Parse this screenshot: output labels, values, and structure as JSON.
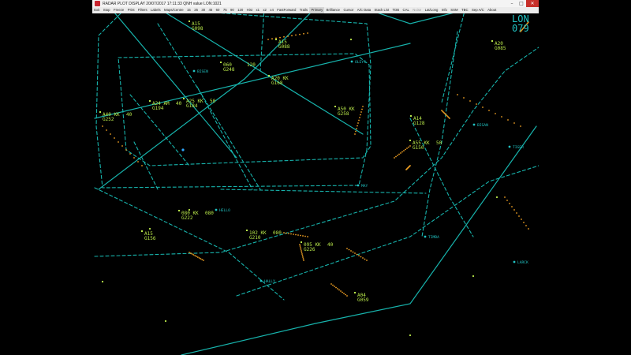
{
  "window": {
    "title": "RADAR PLOT DISPLAY  20/07/2017  17:11:33  QNH value  LON:1021",
    "buttons": [
      "–",
      "□",
      "✕"
    ]
  },
  "menu": [
    {
      "label": "Exit"
    },
    {
      "label": "Stop"
    },
    {
      "label": "Freeze"
    },
    {
      "label": "Print"
    },
    {
      "label": "Filters"
    },
    {
      "label": "Labels"
    },
    {
      "label": "Maps/Centre"
    },
    {
      "label": "15"
    },
    {
      "label": "25"
    },
    {
      "label": "30"
    },
    {
      "label": "45"
    },
    {
      "label": "60"
    },
    {
      "label": "75"
    },
    {
      "label": "90"
    },
    {
      "label": "120"
    },
    {
      "label": "Hist"
    },
    {
      "label": "x1"
    },
    {
      "label": "x2"
    },
    {
      "label": "x4"
    },
    {
      "label": "FastForward"
    },
    {
      "label": "Trails"
    },
    {
      "label": "Primary",
      "active": true
    },
    {
      "label": "Brilliance"
    },
    {
      "label": "Cursor"
    },
    {
      "label": "A/C Data"
    },
    {
      "label": "Stack List"
    },
    {
      "label": "TDB"
    },
    {
      "label": "CAL"
    },
    {
      "label": "Noise",
      "dim": true
    },
    {
      "label": "Lat/Long"
    },
    {
      "label": "Info"
    },
    {
      "label": "SSM"
    },
    {
      "label": "TBC"
    },
    {
      "label": "Sep A/C"
    },
    {
      "label": "About"
    }
  ],
  "colors": {
    "map": "#17b3ac",
    "tag": "#b9e84a",
    "history": "#f0a023",
    "fix": "#21c3c3",
    "cursor": "#2fa8ff",
    "bg": "#000000"
  },
  "corner": {
    "top": "LON",
    "bottom": "079"
  },
  "fixes": [
    {
      "label": "BISEN"
    },
    {
      "label": "OLEYS"
    },
    {
      "label": "BISAN"
    },
    {
      "label": "TIGER"
    },
    {
      "label": "MAY"
    },
    {
      "label": "HELLO"
    },
    {
      "label": "TIMBA"
    },
    {
      "label": "LARCK"
    },
    {
      "label": "HALLY"
    }
  ],
  "tracks": [
    {
      "line1": "A15",
      "line2": "G098"
    },
    {
      "line1": "A15",
      "line2": "G088"
    },
    {
      "line1": "A20",
      "line2": "G085"
    },
    {
      "line1": "060",
      "line2": "G248",
      "extra": "120"
    },
    {
      "line1": "A20  KK",
      "line2": "G168"
    },
    {
      "line1": "A24  AM",
      "line2": "G194",
      "extra": "40"
    },
    {
      "line1": "A25  KK",
      "line2": "G184",
      "extra": "50"
    },
    {
      "line1": "A40  KK",
      "line2": "G252",
      "extra": "40"
    },
    {
      "line1": "A50  KK",
      "line2": "G258"
    },
    {
      "line1": "A14",
      "line2": "G128"
    },
    {
      "line1": "A55  KK",
      "line2": "G150",
      "extra": "50"
    },
    {
      "line1": "080  KK",
      "line2": "G222",
      "extra": "080"
    },
    {
      "line1": "A15",
      "line2": "G156"
    },
    {
      "line1": "102  KK",
      "line2": "G210",
      "extra": "080"
    },
    {
      "line1": "095  KK",
      "line2": "G226",
      "extra": "40"
    },
    {
      "line1": "A04",
      "line2": "G059"
    }
  ]
}
